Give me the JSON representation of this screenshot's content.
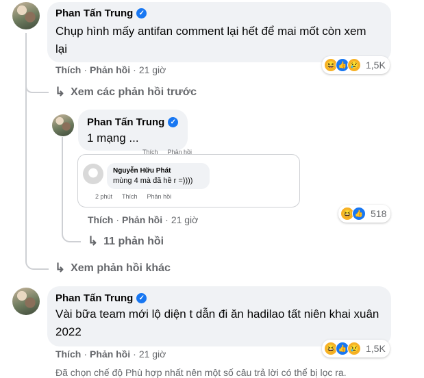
{
  "comment1": {
    "author": "Phan Tấn Trung",
    "text": "Chụp hình mấy antifan comment lại hết để mai mốt còn xem lại",
    "like": "Thích",
    "reply": "Phản hồi",
    "time": "21 giờ",
    "reaction_count": "1,5K",
    "reactions": [
      "haha-icon",
      "like-icon",
      "sad-icon"
    ]
  },
  "view_previous": "Xem các phản hồi trước",
  "reply1": {
    "author": "Phan Tấn Trung",
    "text": "1 mạng ...",
    "partial_like": "Thích",
    "partial_reply": "Phản hồi",
    "embedded": {
      "author": "Nguyễn Hữu Phát",
      "text": "mùng 4 mà đã hề r =))))",
      "time": "2 phút",
      "like": "Thích",
      "reply": "Phản hồi"
    },
    "like": "Thích",
    "reply": "Phản hồi",
    "time": "21 giờ",
    "reaction_count": "518",
    "reactions": [
      "haha-icon",
      "like-icon"
    ],
    "replies_link": "11 phản hồi"
  },
  "view_more": "Xem phản hồi khác",
  "comment2": {
    "author": "Phan Tấn Trung",
    "text": "Vài bữa team mới lộ diện t dẫn đi ăn hadilao tất niên khai xuân 2022",
    "like": "Thích",
    "reply": "Phản hồi",
    "time": "21 giờ",
    "reaction_count": "1,5K",
    "reactions": [
      "haha-icon",
      "like-icon",
      "sad-icon"
    ]
  },
  "filter_note": "Đã chọn chế độ Phù hợp nhất nên một số câu trả lời có thể bị lọc ra."
}
